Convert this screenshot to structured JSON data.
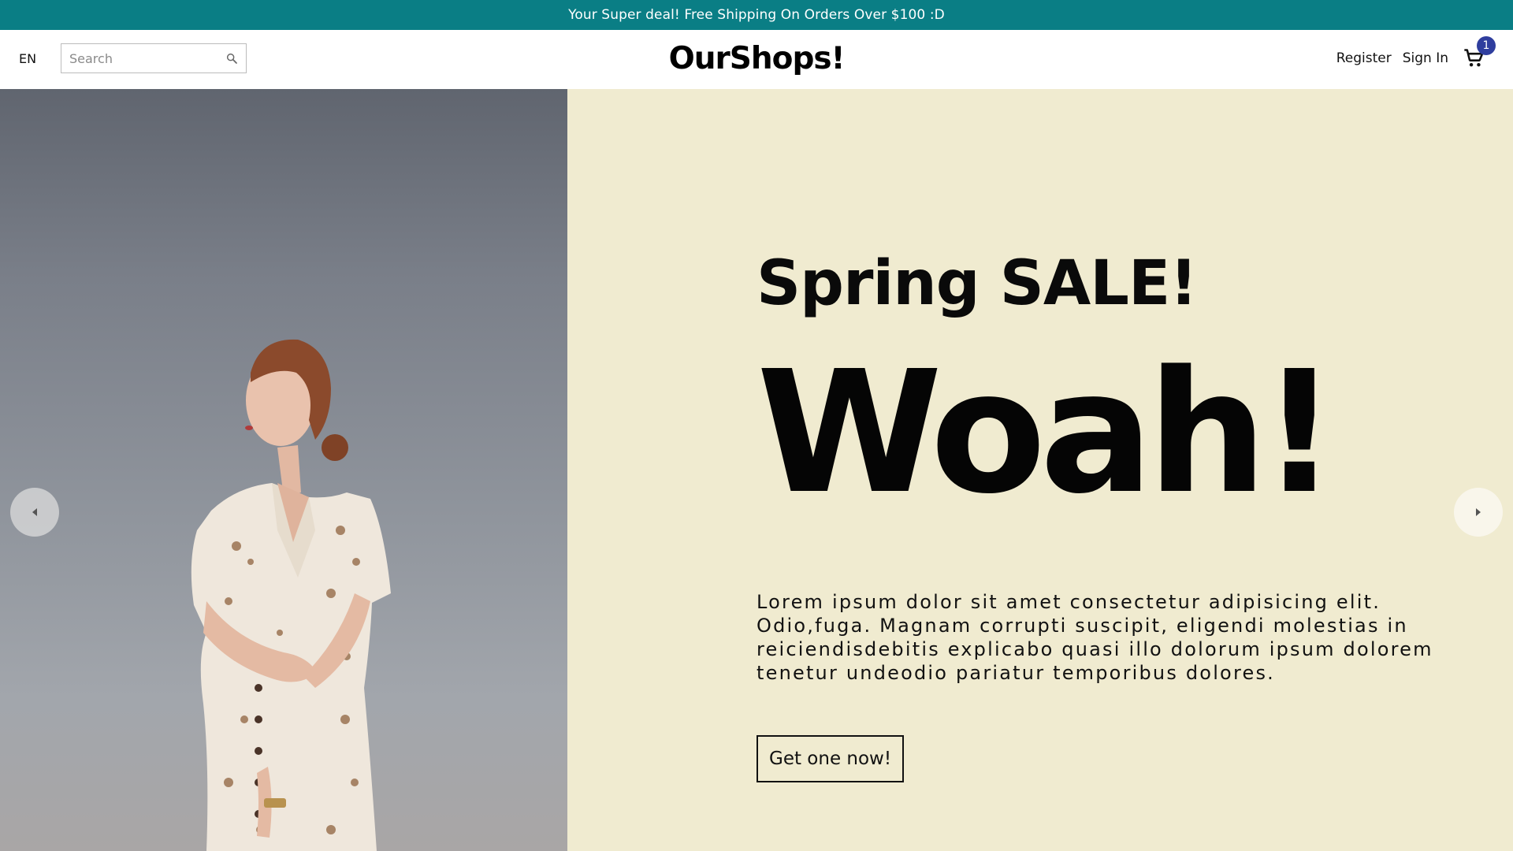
{
  "announcement": {
    "text": "Your Super deal! Free Shipping On Orders Over $100 :D"
  },
  "header": {
    "language": "EN",
    "search": {
      "placeholder": "Search",
      "value": ""
    },
    "logo": "OurShops!",
    "register_label": "Register",
    "signin_label": "Sign In",
    "cart_count": "1"
  },
  "hero": {
    "title": "Spring SALE!",
    "headline": "Woah!",
    "description": "Lorem ipsum dolor sit amet consectetur adipisicing elit. Odio,fuga. Magnam corrupti suscipit, eligendi molestias in reiciendisdebitis explicabo quasi illo dolorum ipsum dolorem tenetur undeodio pariatur temporibus dolores.",
    "cta_label": "Get one now!",
    "background_color": "#f0ebd0"
  },
  "icons": {
    "search": "search-icon",
    "cart": "cart-icon",
    "prev": "chevron-left-icon",
    "next": "chevron-right-icon"
  },
  "colors": {
    "announcement_bg": "#0a7e85",
    "badge_bg": "#2f3e9e"
  }
}
